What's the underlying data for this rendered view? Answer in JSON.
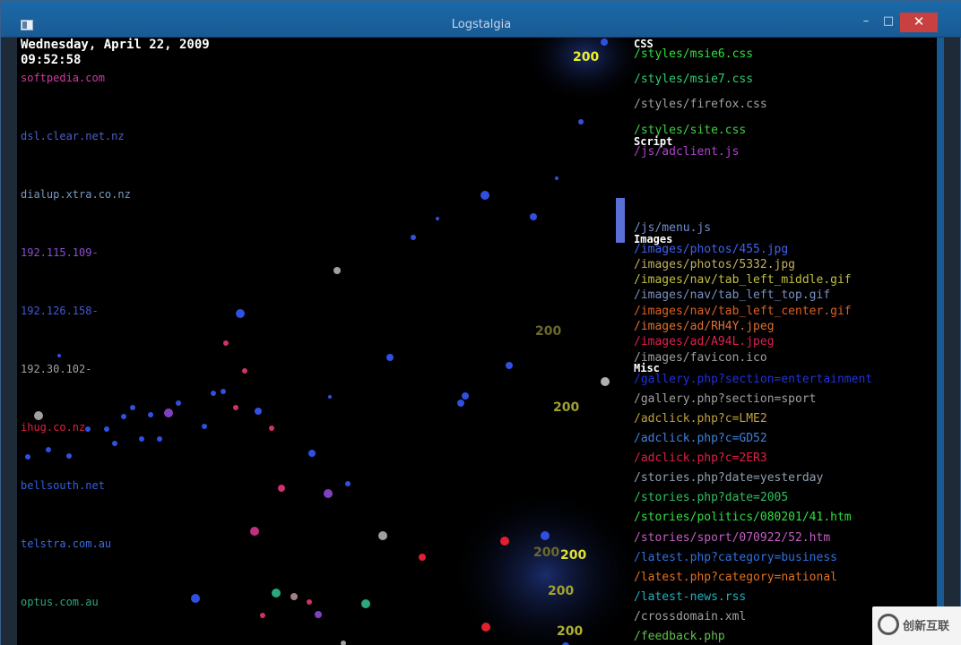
{
  "window": {
    "title": "Logstalgia"
  },
  "controls": {
    "minimize": "–",
    "maximize": "□",
    "close": "✕"
  },
  "clock": {
    "date": "Wednesday, April 22, 2009",
    "time": "09:52:58"
  },
  "hosts": [
    {
      "label": "softpedia.com",
      "color": "#d23aa0"
    },
    {
      "label": "dsl.clear.net.nz",
      "color": "#4a5fd0"
    },
    {
      "label": "dialup.xtra.co.nz",
      "color": "#7a98c0"
    },
    {
      "label": "192.115.109-",
      "color": "#8a4fcf"
    },
    {
      "label": "192.126.158-",
      "color": "#3f59d8"
    },
    {
      "label": "192.30.102-",
      "color": "#a0a0a0"
    },
    {
      "label": "ihug.co.nz",
      "color": "#e02040"
    },
    {
      "label": "bellsouth.net",
      "color": "#3060e0"
    },
    {
      "label": "telstra.com.au",
      "color": "#3a6ae0"
    },
    {
      "label": "optus.com.au",
      "color": "#2aa880"
    }
  ],
  "groups": {
    "css": "CSS",
    "script": "Script",
    "images": "Images",
    "misc": "Misc"
  },
  "paths": [
    {
      "label": "/styles/msie6.css",
      "color": "#30e040"
    },
    {
      "label": "/styles/msie7.css",
      "color": "#30d070"
    },
    {
      "label": "/styles/firefox.css",
      "color": "#a0a0a0"
    },
    {
      "label": "/styles/site.css",
      "color": "#40d040"
    },
    {
      "label": "/js/adclient.js",
      "color": "#b040d0"
    },
    {
      "label": "/js/menu.js",
      "color": "#6e8ed0"
    },
    {
      "label": "/images/photos/455.jpg",
      "color": "#4060f0"
    },
    {
      "label": "/images/photos/5332.jpg",
      "color": "#c0b060"
    },
    {
      "label": "/images/nav/tab_left_middle.gif",
      "color": "#c0c040"
    },
    {
      "label": "/images/nav/tab_left_top.gif",
      "color": "#7890c0"
    },
    {
      "label": "/images/nav/tab_left_center.gif",
      "color": "#e06020"
    },
    {
      "label": "/images/ad/RH4Y.jpeg",
      "color": "#e07030"
    },
    {
      "label": "/images/ad/A94L.jpeg",
      "color": "#e02050"
    },
    {
      "label": "/images/favicon.ico",
      "color": "#a0a0a0"
    },
    {
      "label": "/gallery.php?section=entertainment",
      "color": "#2030e0"
    },
    {
      "label": "/gallery.php?section=sport",
      "color": "#a0a0a0"
    },
    {
      "label": "/adclick.php?c=LME2",
      "color": "#c0a040"
    },
    {
      "label": "/adclick.php?c=GD52",
      "color": "#4080e0"
    },
    {
      "label": "/adclick.php?c=2ER3",
      "color": "#e02040"
    },
    {
      "label": "/stories.php?date=yesterday",
      "color": "#90a0b0"
    },
    {
      "label": "/stories.php?date=2005",
      "color": "#30c060"
    },
    {
      "label": "/stories/politics/080201/41.htm",
      "color": "#30e040"
    },
    {
      "label": "/stories/sport/070922/52.htm",
      "color": "#c060c0"
    },
    {
      "label": "/latest.php?category=business",
      "color": "#3070e0"
    },
    {
      "label": "/latest.php?category=national",
      "color": "#e07020"
    },
    {
      "label": "/latest-news.rss",
      "color": "#20b0c0"
    },
    {
      "label": "/crossdomain.xml",
      "color": "#a0a0a0"
    },
    {
      "label": "/feedback.php",
      "color": "#60c050"
    }
  ],
  "codes": [
    {
      "label": "200",
      "color": "#f0f020"
    },
    {
      "label": "200",
      "color": "#6a6a2a"
    },
    {
      "label": "200",
      "color": "#a0a030"
    },
    {
      "label": "200",
      "color": "#6a6a2a"
    },
    {
      "label": "200",
      "color": "#e0e030"
    },
    {
      "label": "200",
      "color": "#a0a030"
    },
    {
      "label": "200",
      "color": "#b0b030"
    },
    {
      "label": "200",
      "color": "#a0a030"
    }
  ],
  "colors": {
    "paddle": "#5b70d6",
    "background": "#000000"
  },
  "watermark": {
    "text": "创新互联"
  }
}
